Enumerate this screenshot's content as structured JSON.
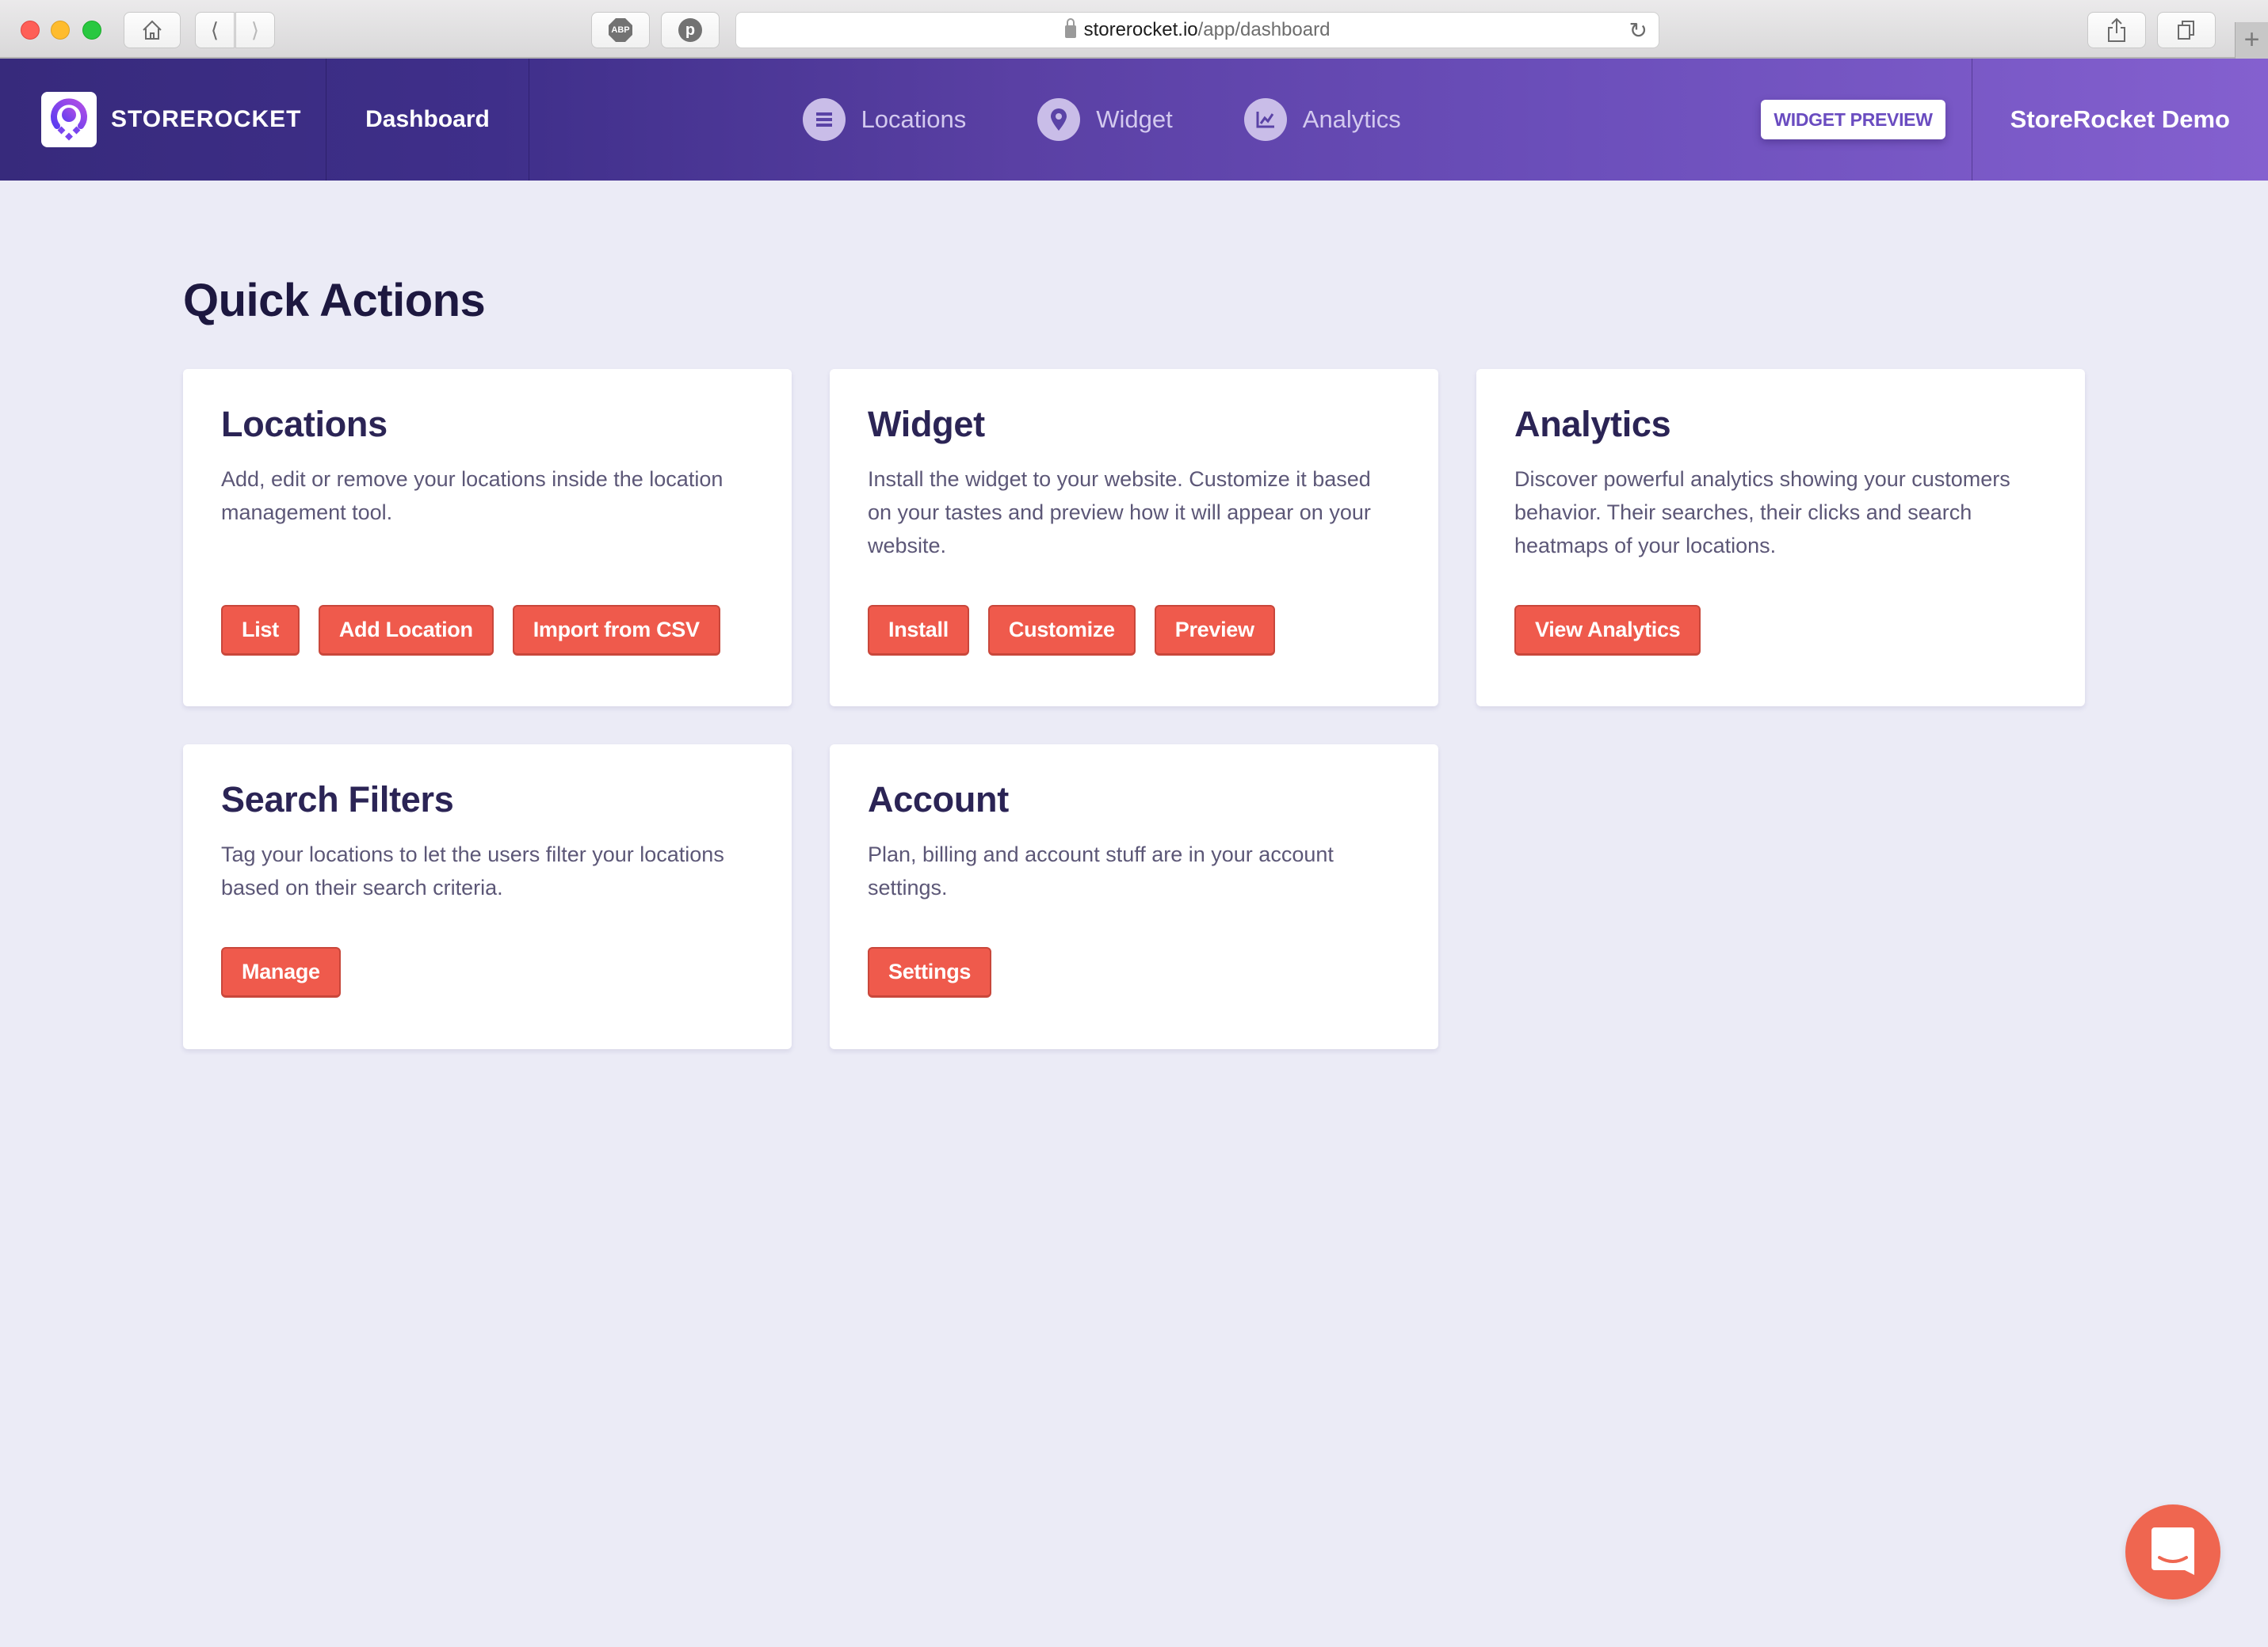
{
  "browser": {
    "url_domain": "storerocket.io",
    "url_path": "/app/dashboard",
    "toolbar_icons": [
      "home-icon",
      "back-icon",
      "forward-icon",
      "adblock-icon",
      "pinterest-icon",
      "reload-icon",
      "share-icon",
      "tabs-icon",
      "new-tab-icon"
    ],
    "adblock_label": "ABP"
  },
  "navbar": {
    "brand": "STOREROCKET",
    "dashboard": "Dashboard",
    "items": [
      {
        "label": "Locations",
        "icon": "list-icon"
      },
      {
        "label": "Widget",
        "icon": "map-pin-icon"
      },
      {
        "label": "Analytics",
        "icon": "chart-icon"
      }
    ],
    "widget_preview": "WIDGET PREVIEW",
    "account": "StoreRocket Demo"
  },
  "main": {
    "title": "Quick Actions",
    "cards": [
      {
        "title": "Locations",
        "description": "Add, edit or remove your locations inside the location management tool.",
        "buttons": [
          "List",
          "Add Location",
          "Import from CSV"
        ]
      },
      {
        "title": "Widget",
        "description": "Install the widget to your website. Customize it based on your tastes and preview how it will appear on your website.",
        "buttons": [
          "Install",
          "Customize",
          "Preview"
        ]
      },
      {
        "title": "Analytics",
        "description": "Discover powerful analytics showing your customers behavior. Their searches, their clicks and search heatmaps of your locations.",
        "buttons": [
          "View Analytics"
        ]
      },
      {
        "title": "Search Filters",
        "description": "Tag your locations to let the users filter your locations based on their search criteria.",
        "buttons": [
          "Manage"
        ]
      },
      {
        "title": "Account",
        "description": "Plan, billing and account stuff are in your account settings.",
        "buttons": [
          "Settings"
        ]
      }
    ]
  },
  "chat": {
    "icon": "chat-icon"
  },
  "colors": {
    "accent_button": "#ef5a4c",
    "nav_start": "#372a7c",
    "nav_end": "#8460cf",
    "background": "#ebebf6",
    "heading": "#2b2455"
  }
}
